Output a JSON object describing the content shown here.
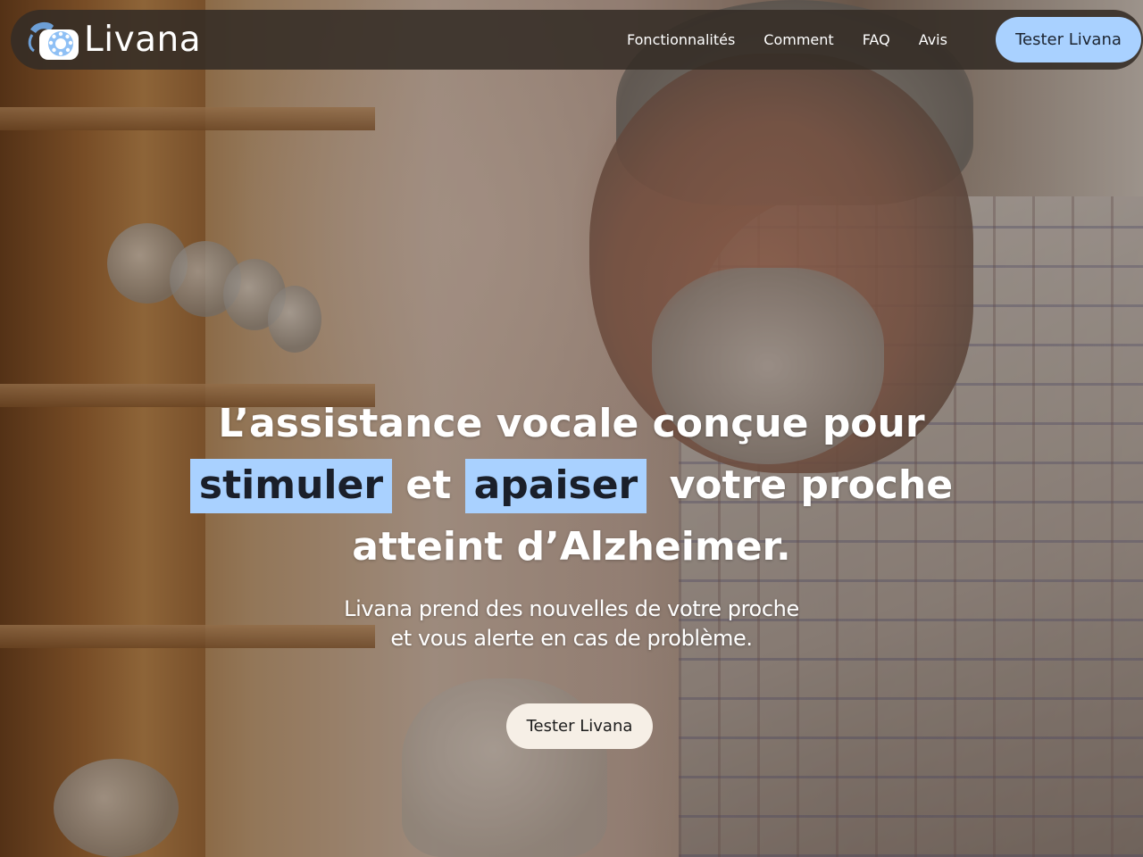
{
  "brand": {
    "name": "Livana",
    "logo_icon": "rotary-phone-icon"
  },
  "nav": {
    "links": [
      {
        "label": "Fonctionnalités"
      },
      {
        "label": "Comment"
      },
      {
        "label": "FAQ"
      },
      {
        "label": "Avis"
      }
    ],
    "cta_label": "Tester Livana"
  },
  "hero": {
    "title_line1": "L’assistance vocale conçue pour",
    "title_hl1": "stimuler",
    "title_mid": "et",
    "title_hl2": "apaiser",
    "title_line2_end": " votre proche",
    "title_line3": "atteint d’Alzheimer.",
    "subtitle_line1": "Livana prend des nouvelles de votre proche",
    "subtitle_line2": "et vous alerte en cas de problème.",
    "cta_label": "Tester Livana"
  },
  "colors": {
    "accent": "#a9d1ff",
    "hero_cta_bg": "#f6efe6",
    "navbar_bg": "#342c26"
  }
}
